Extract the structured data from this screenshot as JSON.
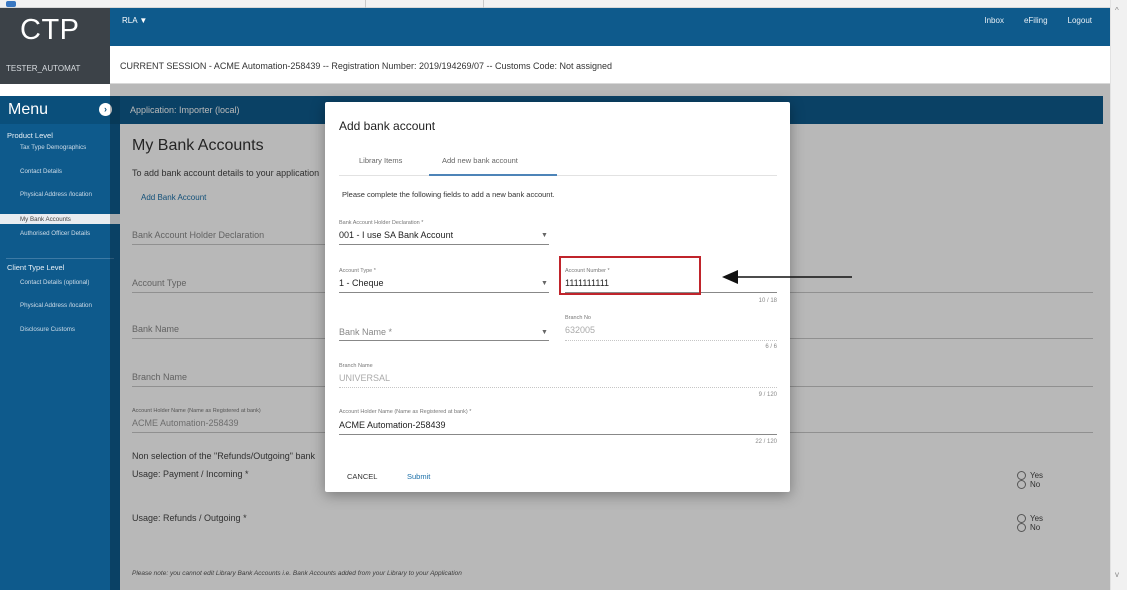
{
  "header": {
    "logo": "CTP",
    "username": "TESTER_AUTOMAT",
    "rla_menu": "RLA ▼",
    "links": [
      "Inbox",
      "eFiling",
      "Logout"
    ],
    "session": "CURRENT SESSION - ACME Automation-258439 -- Registration Number: 2019/194269/07 -- Customs Code: Not assigned"
  },
  "sidebar": {
    "title": "Menu",
    "section_product": "Product Level",
    "product_items": [
      "Tax Type Demographics",
      "Contact Details",
      "Physical Address /location",
      "My Bank Accounts",
      "Authorised Officer Details"
    ],
    "active_item": "My Bank Accounts",
    "section_client": "Client Type Level",
    "client_items": [
      "Contact Details (optional)",
      "Physical Address /location",
      "Disclosure Customs"
    ]
  },
  "main": {
    "app_bar": "Application: Importer (local)",
    "title": "My Bank Accounts",
    "intro": "To add bank account details to your application",
    "add_link": "Add Bank Account",
    "bank_holder_label": "Bank Account Holder Declaration",
    "account_type_label": "Account Type",
    "bank_name_label": "Bank Name",
    "branch_name_label": "Branch Name",
    "holder_name_small": "Account Holder Name (Name as Registered at bank)",
    "holder_name_value": "ACME Automation-258439",
    "non_selection": "Non selection of the \"Refunds/Outgoing\" bank",
    "usage_payment": "Usage: Payment / Incoming *",
    "usage_refunds": "Usage: Refunds / Outgoing *",
    "yes": "Yes",
    "no": "No",
    "note": "Please note: you cannot edit Library Bank Accounts i.e. Bank Accounts added from your Library to your Application"
  },
  "dialog": {
    "title": "Add bank account",
    "tab_library": "Library Items",
    "tab_new": "Add new bank account",
    "instructions": "Please complete the following fields to add a new bank account.",
    "declaration_label": "Bank Account Holder Declaration *",
    "declaration_value": "001 - I use SA Bank Account",
    "account_type_label": "Account Type *",
    "account_type_value": "1 - Cheque",
    "account_number_label": "Account Number *",
    "account_number_value": "1111111111",
    "account_number_counter": "10 / 18",
    "bank_name_placeholder": "Bank Name  *",
    "branch_no_label": "Branch No",
    "branch_no_value": "632005",
    "branch_no_counter": "6 / 6",
    "branch_name_label": "Branch Name",
    "branch_name_value": "UNIVERSAL",
    "branch_name_counter": "9 / 120",
    "holder_label": "Account Holder Name (Name as Registered at bank) *",
    "holder_value": "ACME Automation-258439",
    "holder_counter": "22 / 120",
    "cancel": "CANCEL",
    "submit": "Submit"
  },
  "colors": {
    "brand_blue": "#0e5a8c",
    "logo_bg": "#3c4248",
    "highlight_red": "#c0242b",
    "link_blue": "#1a6fa8"
  }
}
